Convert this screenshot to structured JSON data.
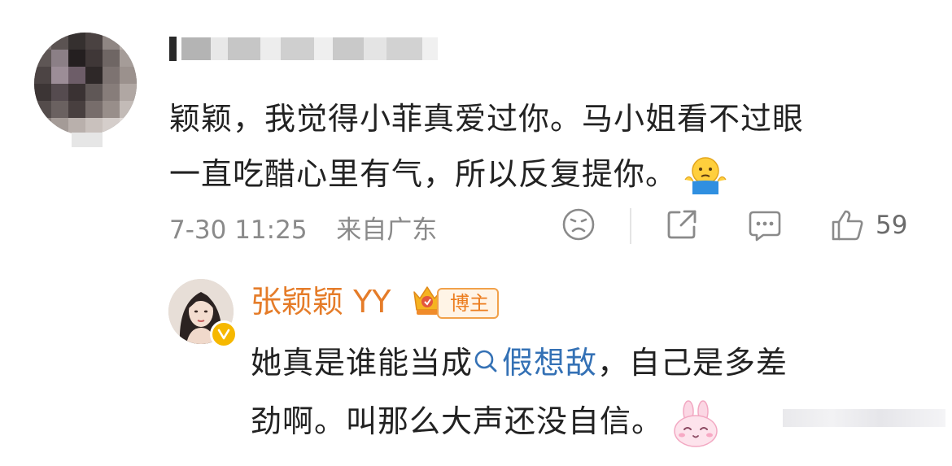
{
  "comment": {
    "line1": "颖颖，我觉得小菲真爱过你。马小姐看不过眼",
    "line2": "一直吃醋心里有气，所以反复提你。",
    "emoji": "shrug-emoji",
    "timestamp": "7-30 11:25",
    "location": "来自广东",
    "like_count": "59",
    "icons": [
      "dislike-face-icon",
      "share-icon",
      "comment-icon",
      "thumb-up-icon"
    ]
  },
  "reply": {
    "name": "张颖颖 YY",
    "badge_label": "博主",
    "text_before_topic": "她真是谁能当成",
    "topic": "假想敌",
    "text_after_topic": "，自己是多差",
    "line2": "劲啊。叫那么大声还没自信。",
    "emoji": "bunny-emoji"
  },
  "colors": {
    "username_orange": "#e57c29",
    "topic_blue": "#3471b5",
    "badge_orange": "#ec7d1e",
    "meta_gray": "#8a8a8a"
  }
}
